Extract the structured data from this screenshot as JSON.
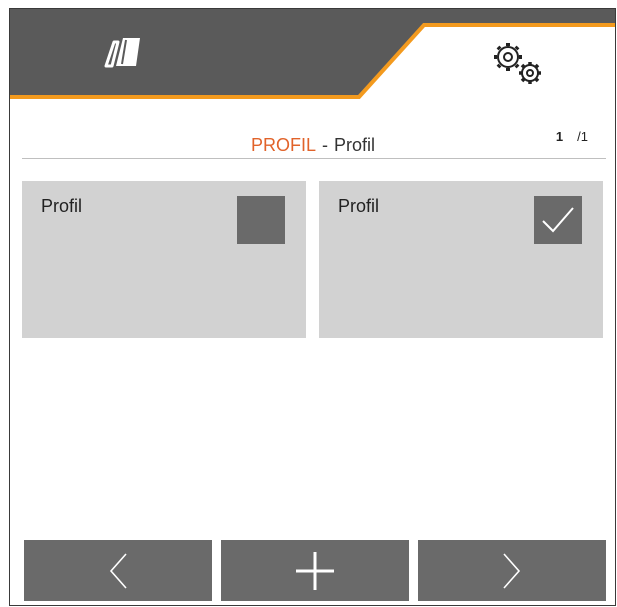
{
  "header": {
    "left_icon": "implement-icon",
    "right_icon": "gears-icon",
    "colors": {
      "bar": "#5a5a5a",
      "accent": "#f39a1e",
      "active_tab": "#ffffff"
    }
  },
  "title": {
    "main": "PROFIL",
    "separator": "-",
    "sub": "Profil",
    "main_color": "#e1632a"
  },
  "pagination": {
    "current": "1",
    "total": "/1"
  },
  "tiles": [
    {
      "label": "Profil",
      "checked": false
    },
    {
      "label": "Profil",
      "checked": true
    }
  ],
  "footer": {
    "buttons": [
      "chevron-left-icon",
      "plus-icon",
      "chevron-right-icon"
    ]
  }
}
